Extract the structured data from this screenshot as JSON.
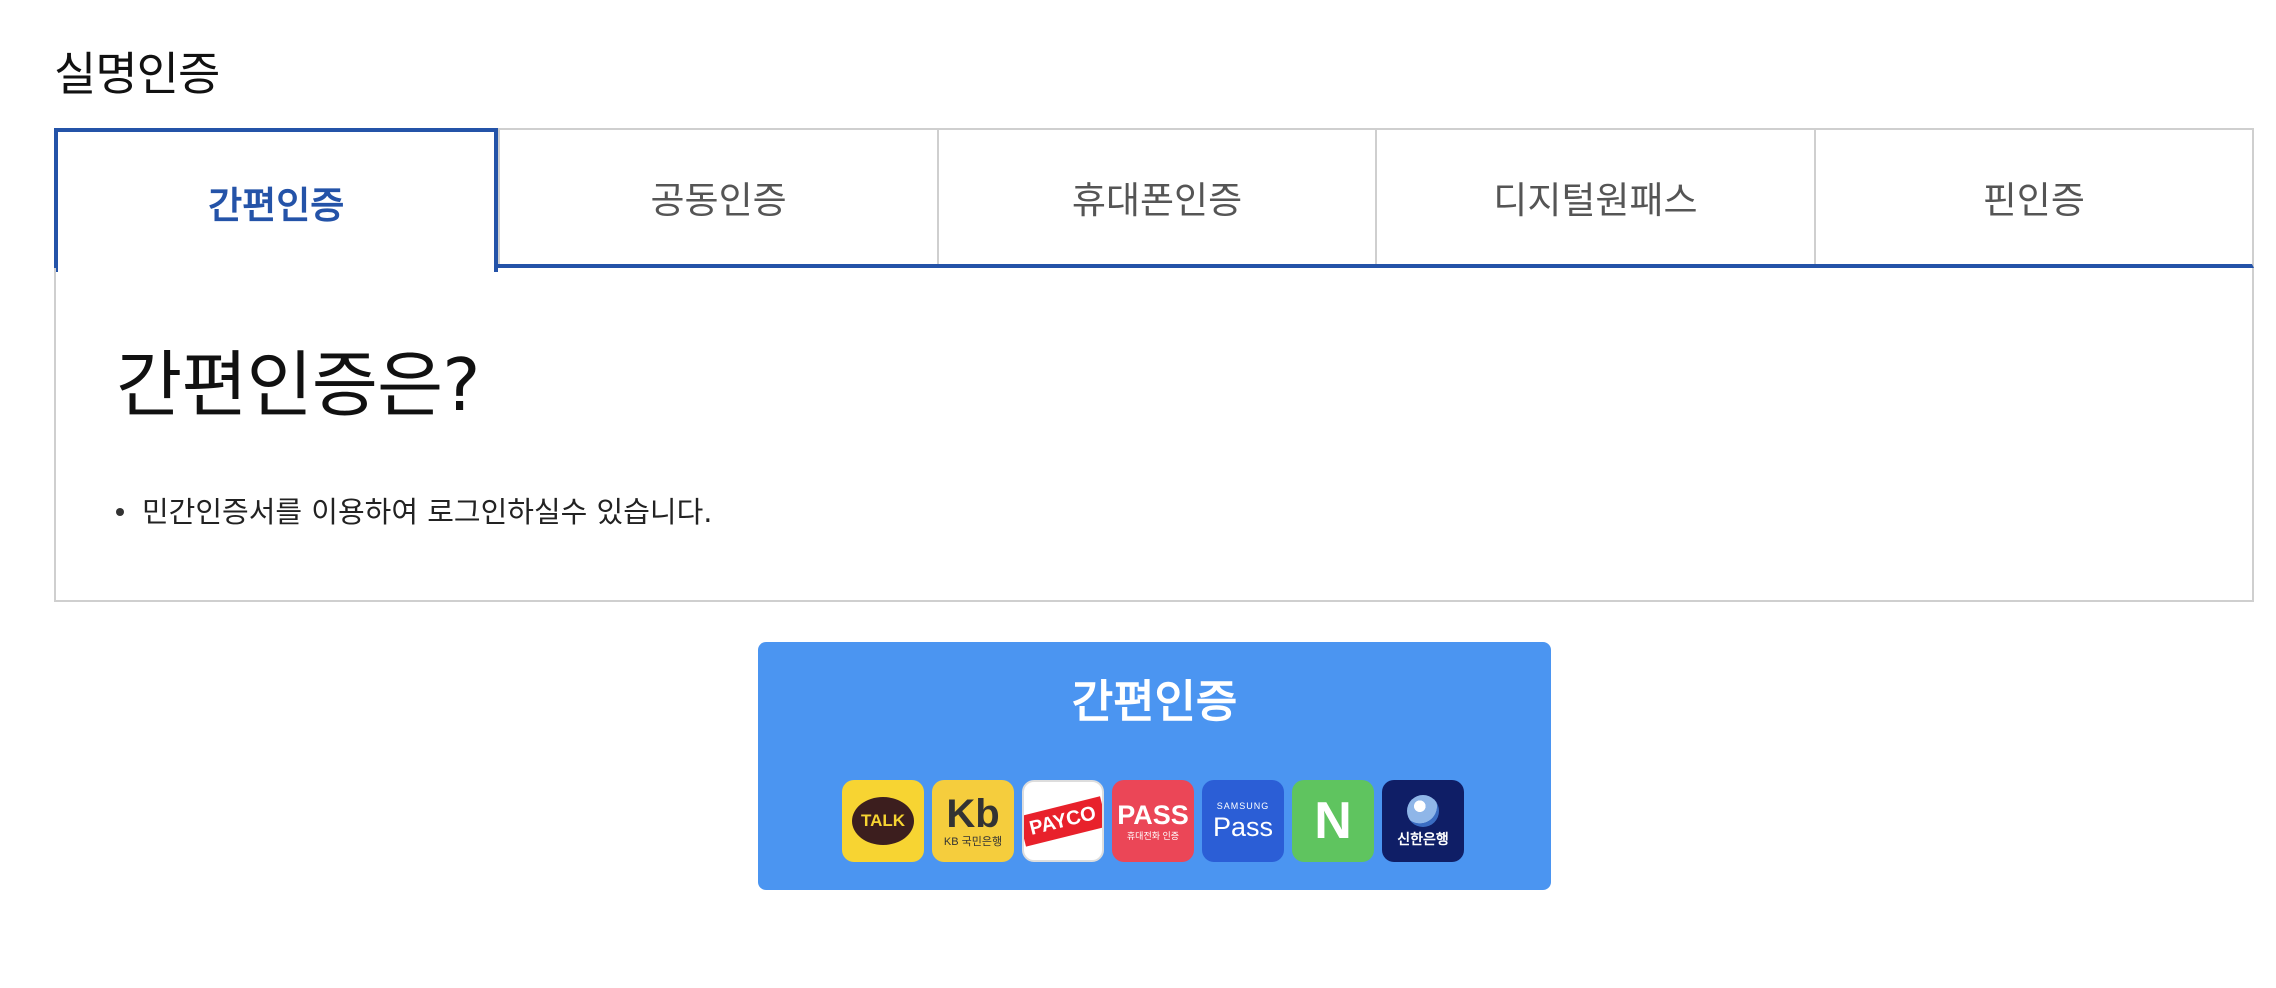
{
  "page": {
    "title": "실명인증"
  },
  "tabs": [
    {
      "label": "간편인증",
      "active": true
    },
    {
      "label": "공동인증",
      "active": false
    },
    {
      "label": "휴대폰인증",
      "active": false
    },
    {
      "label": "디지털원패스",
      "active": false
    },
    {
      "label": "핀인증",
      "active": false
    }
  ],
  "panel": {
    "heading": "간편인증은?",
    "bullets": [
      "민간인증서를 이용하여 로그인하실수 있습니다."
    ]
  },
  "auth_button": {
    "label": "간편인증",
    "color": "#4b95f1",
    "providers": [
      {
        "icon": "kakaotalk-icon",
        "text": "TALK"
      },
      {
        "icon": "kb-bank-icon",
        "mark": "Kb",
        "text": "KB 국민은행"
      },
      {
        "icon": "payco-icon",
        "text": "PAYCO"
      },
      {
        "icon": "pass-icon",
        "text": "PASS",
        "sub": "휴대전화 인증"
      },
      {
        "icon": "samsung-pass-icon",
        "tiny": "SAMSUNG",
        "text": "Pass"
      },
      {
        "icon": "naver-icon",
        "text": "N"
      },
      {
        "icon": "shinhan-bank-icon",
        "text": "신한은행"
      }
    ]
  },
  "colors": {
    "active_tab": "#2453a8",
    "border": "#cfcfcf"
  }
}
